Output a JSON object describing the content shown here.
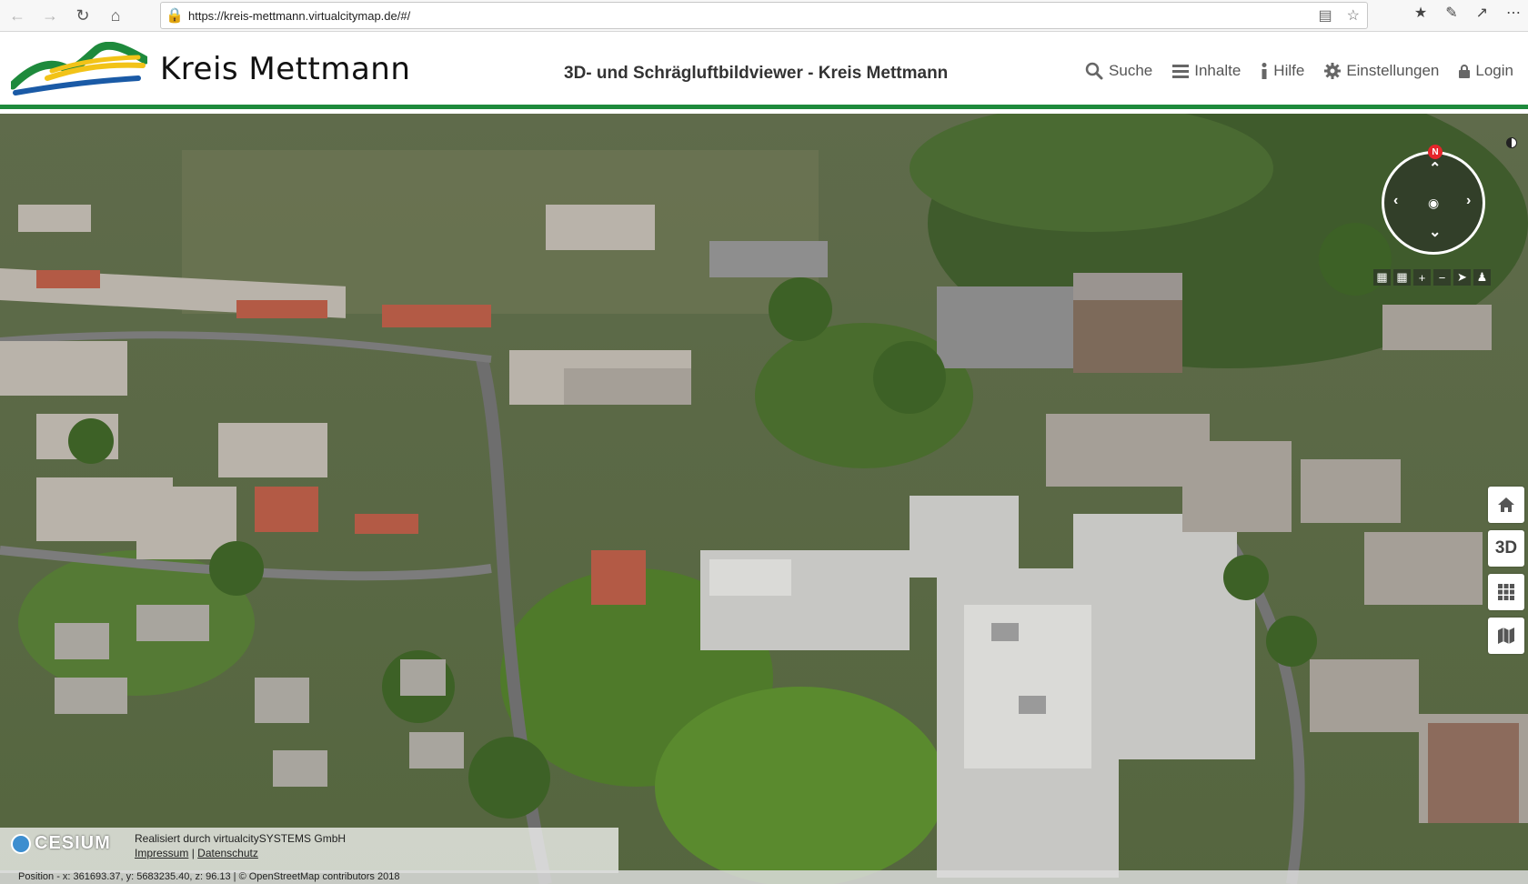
{
  "browser": {
    "url": "https://kreis-mettmann.virtualcitymap.de/#/"
  },
  "header": {
    "logo_text": "Kreis Mettmann",
    "title": "3D- und Schrägluftbildviewer - Kreis Mettmann",
    "menu": {
      "search": "Suche",
      "contents": "Inhalte",
      "help": "Hilfe",
      "settings": "Einstellungen",
      "login": "Login"
    }
  },
  "navigation": {
    "north_label": "N"
  },
  "side_buttons": {
    "mode_3d": "3D"
  },
  "attribution": {
    "cesium_label": "CESIUM",
    "credit": "Realisiert durch virtualcitySYSTEMS GmbH",
    "impressum": "Impressum",
    "separator": "|",
    "datenschutz": "Datenschutz"
  },
  "status": {
    "position_text": "Position - x: 361693.37, y: 5683235.40, z: 96.13 | © OpenStreetMap contributors 2018"
  },
  "colors": {
    "header_accent": "#1e8a3c",
    "compass_north": "#e5252b"
  }
}
